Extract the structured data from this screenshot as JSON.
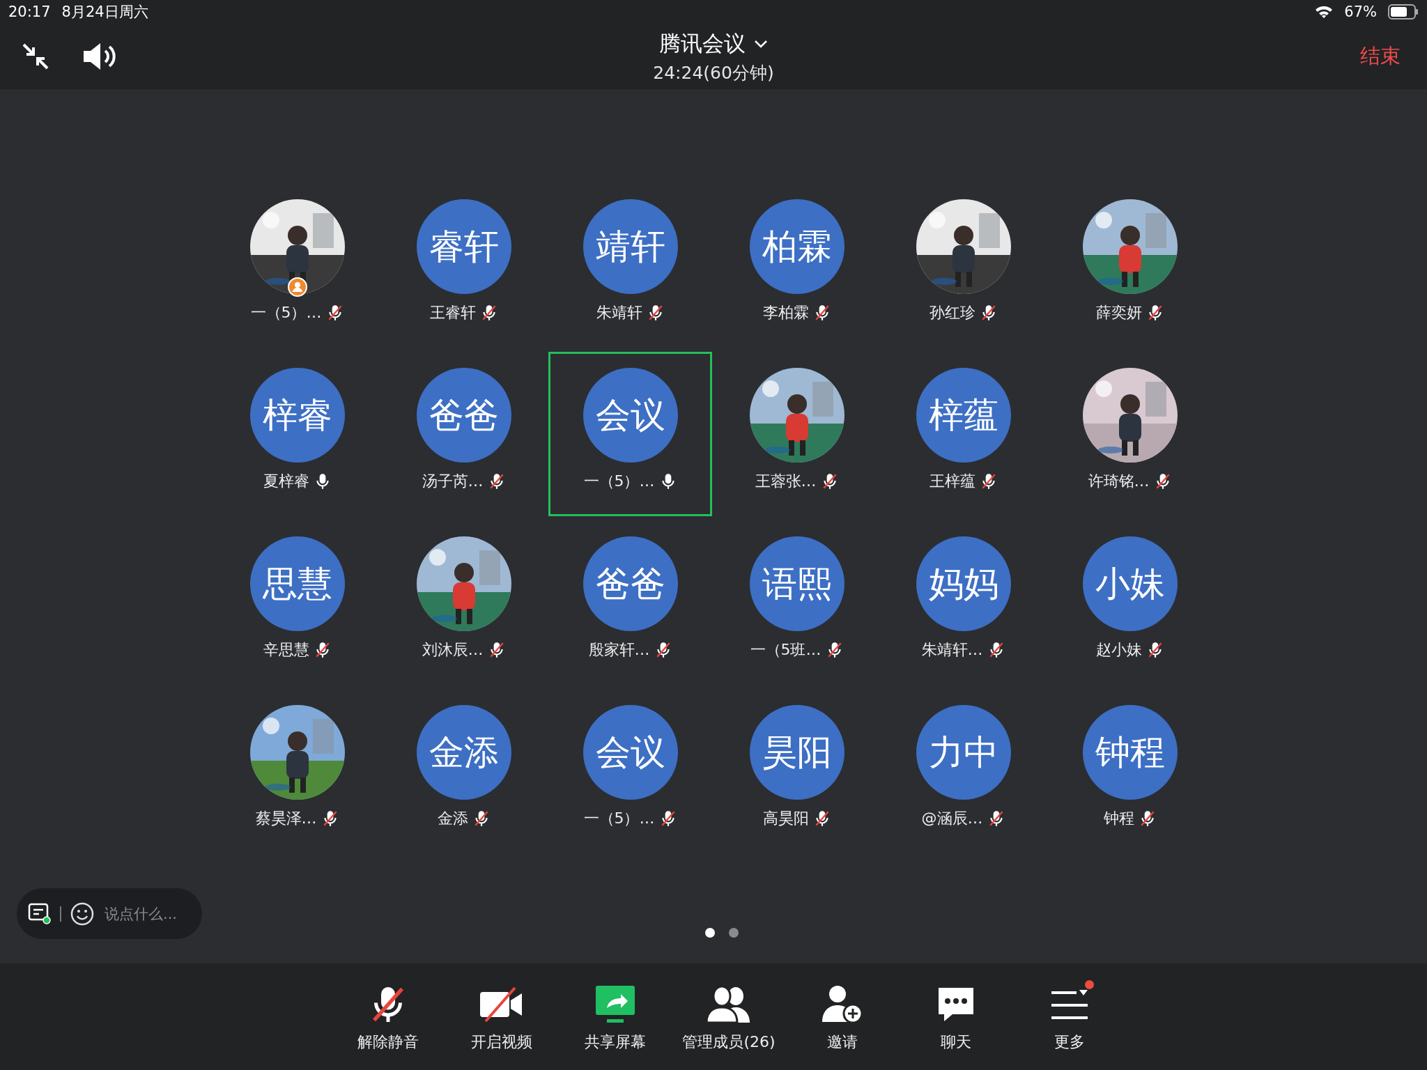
{
  "status_bar": {
    "time": "20:17",
    "date": "8月24日周六",
    "battery": "67%"
  },
  "header": {
    "title": "腾讯会议",
    "duration": "24:24(60分钟)",
    "end_button": "结束"
  },
  "participants": [
    {
      "kind": "picture",
      "name": "一（5）…",
      "muted": true,
      "host": true,
      "selected": false
    },
    {
      "kind": "initials",
      "initials": "睿轩",
      "name": "王睿轩",
      "muted": true,
      "host": false,
      "selected": false
    },
    {
      "kind": "initials",
      "initials": "靖轩",
      "name": "朱靖轩",
      "muted": true,
      "host": false,
      "selected": false
    },
    {
      "kind": "initials",
      "initials": "柏霖",
      "name": "李柏霖",
      "muted": true,
      "host": false,
      "selected": false
    },
    {
      "kind": "picture",
      "name": "孙红珍",
      "muted": true,
      "host": false,
      "selected": false
    },
    {
      "kind": "picture",
      "name": "薛奕妍",
      "muted": true,
      "host": false,
      "selected": false
    },
    {
      "kind": "initials",
      "initials": "梓睿",
      "name": "夏梓睿",
      "muted": false,
      "host": false,
      "selected": false
    },
    {
      "kind": "initials",
      "initials": "爸爸",
      "name": "汤子芮…",
      "muted": true,
      "host": false,
      "selected": false
    },
    {
      "kind": "initials",
      "initials": "会议",
      "name": "一（5）…",
      "muted": false,
      "host": false,
      "selected": true
    },
    {
      "kind": "picture",
      "name": "王蓉张…",
      "muted": true,
      "host": false,
      "selected": false
    },
    {
      "kind": "initials",
      "initials": "梓蕴",
      "name": "王梓蕴",
      "muted": true,
      "host": false,
      "selected": false
    },
    {
      "kind": "picture",
      "name": "许琦铭…",
      "muted": true,
      "host": false,
      "selected": false
    },
    {
      "kind": "initials",
      "initials": "思慧",
      "name": "辛思慧",
      "muted": true,
      "host": false,
      "selected": false
    },
    {
      "kind": "picture",
      "name": "刘沐辰…",
      "muted": true,
      "host": false,
      "selected": false
    },
    {
      "kind": "initials",
      "initials": "爸爸",
      "name": "殷家轩…",
      "muted": true,
      "host": false,
      "selected": false
    },
    {
      "kind": "initials",
      "initials": "语熙",
      "name": "一（5班…",
      "muted": true,
      "host": false,
      "selected": false
    },
    {
      "kind": "initials",
      "initials": "妈妈",
      "name": "朱靖轩…",
      "muted": true,
      "host": false,
      "selected": false
    },
    {
      "kind": "initials",
      "initials": "小妹",
      "name": "赵小妹",
      "muted": true,
      "host": false,
      "selected": false
    },
    {
      "kind": "picture",
      "name": "蔡昊泽…",
      "muted": true,
      "host": false,
      "selected": false
    },
    {
      "kind": "initials",
      "initials": "金添",
      "name": "金添",
      "muted": true,
      "host": false,
      "selected": false
    },
    {
      "kind": "initials",
      "initials": "会议",
      "name": "一（5）…",
      "muted": true,
      "host": false,
      "selected": false
    },
    {
      "kind": "initials",
      "initials": "昊阳",
      "name": "高昊阳",
      "muted": true,
      "host": false,
      "selected": false
    },
    {
      "kind": "initials",
      "initials": "力中",
      "name": "@涵辰…",
      "muted": true,
      "host": false,
      "selected": false
    },
    {
      "kind": "initials",
      "initials": "钟程",
      "name": "钟程",
      "muted": true,
      "host": false,
      "selected": false
    }
  ],
  "chat_input": {
    "placeholder": "说点什么..."
  },
  "page_dots": [
    {
      "selected": true
    },
    {
      "selected": false
    }
  ],
  "toolbar": [
    {
      "kind": "mic",
      "label": "解除静音",
      "badge": false
    },
    {
      "kind": "video",
      "label": "开启视频",
      "badge": false
    },
    {
      "kind": "share",
      "label": "共享屏幕",
      "badge": false
    },
    {
      "kind": "members",
      "label": "管理成员(26)",
      "badge": false
    },
    {
      "kind": "invite",
      "label": "邀请",
      "badge": false
    },
    {
      "kind": "chat",
      "label": "聊天",
      "badge": false
    },
    {
      "kind": "more",
      "label": "更多",
      "badge": true
    }
  ]
}
